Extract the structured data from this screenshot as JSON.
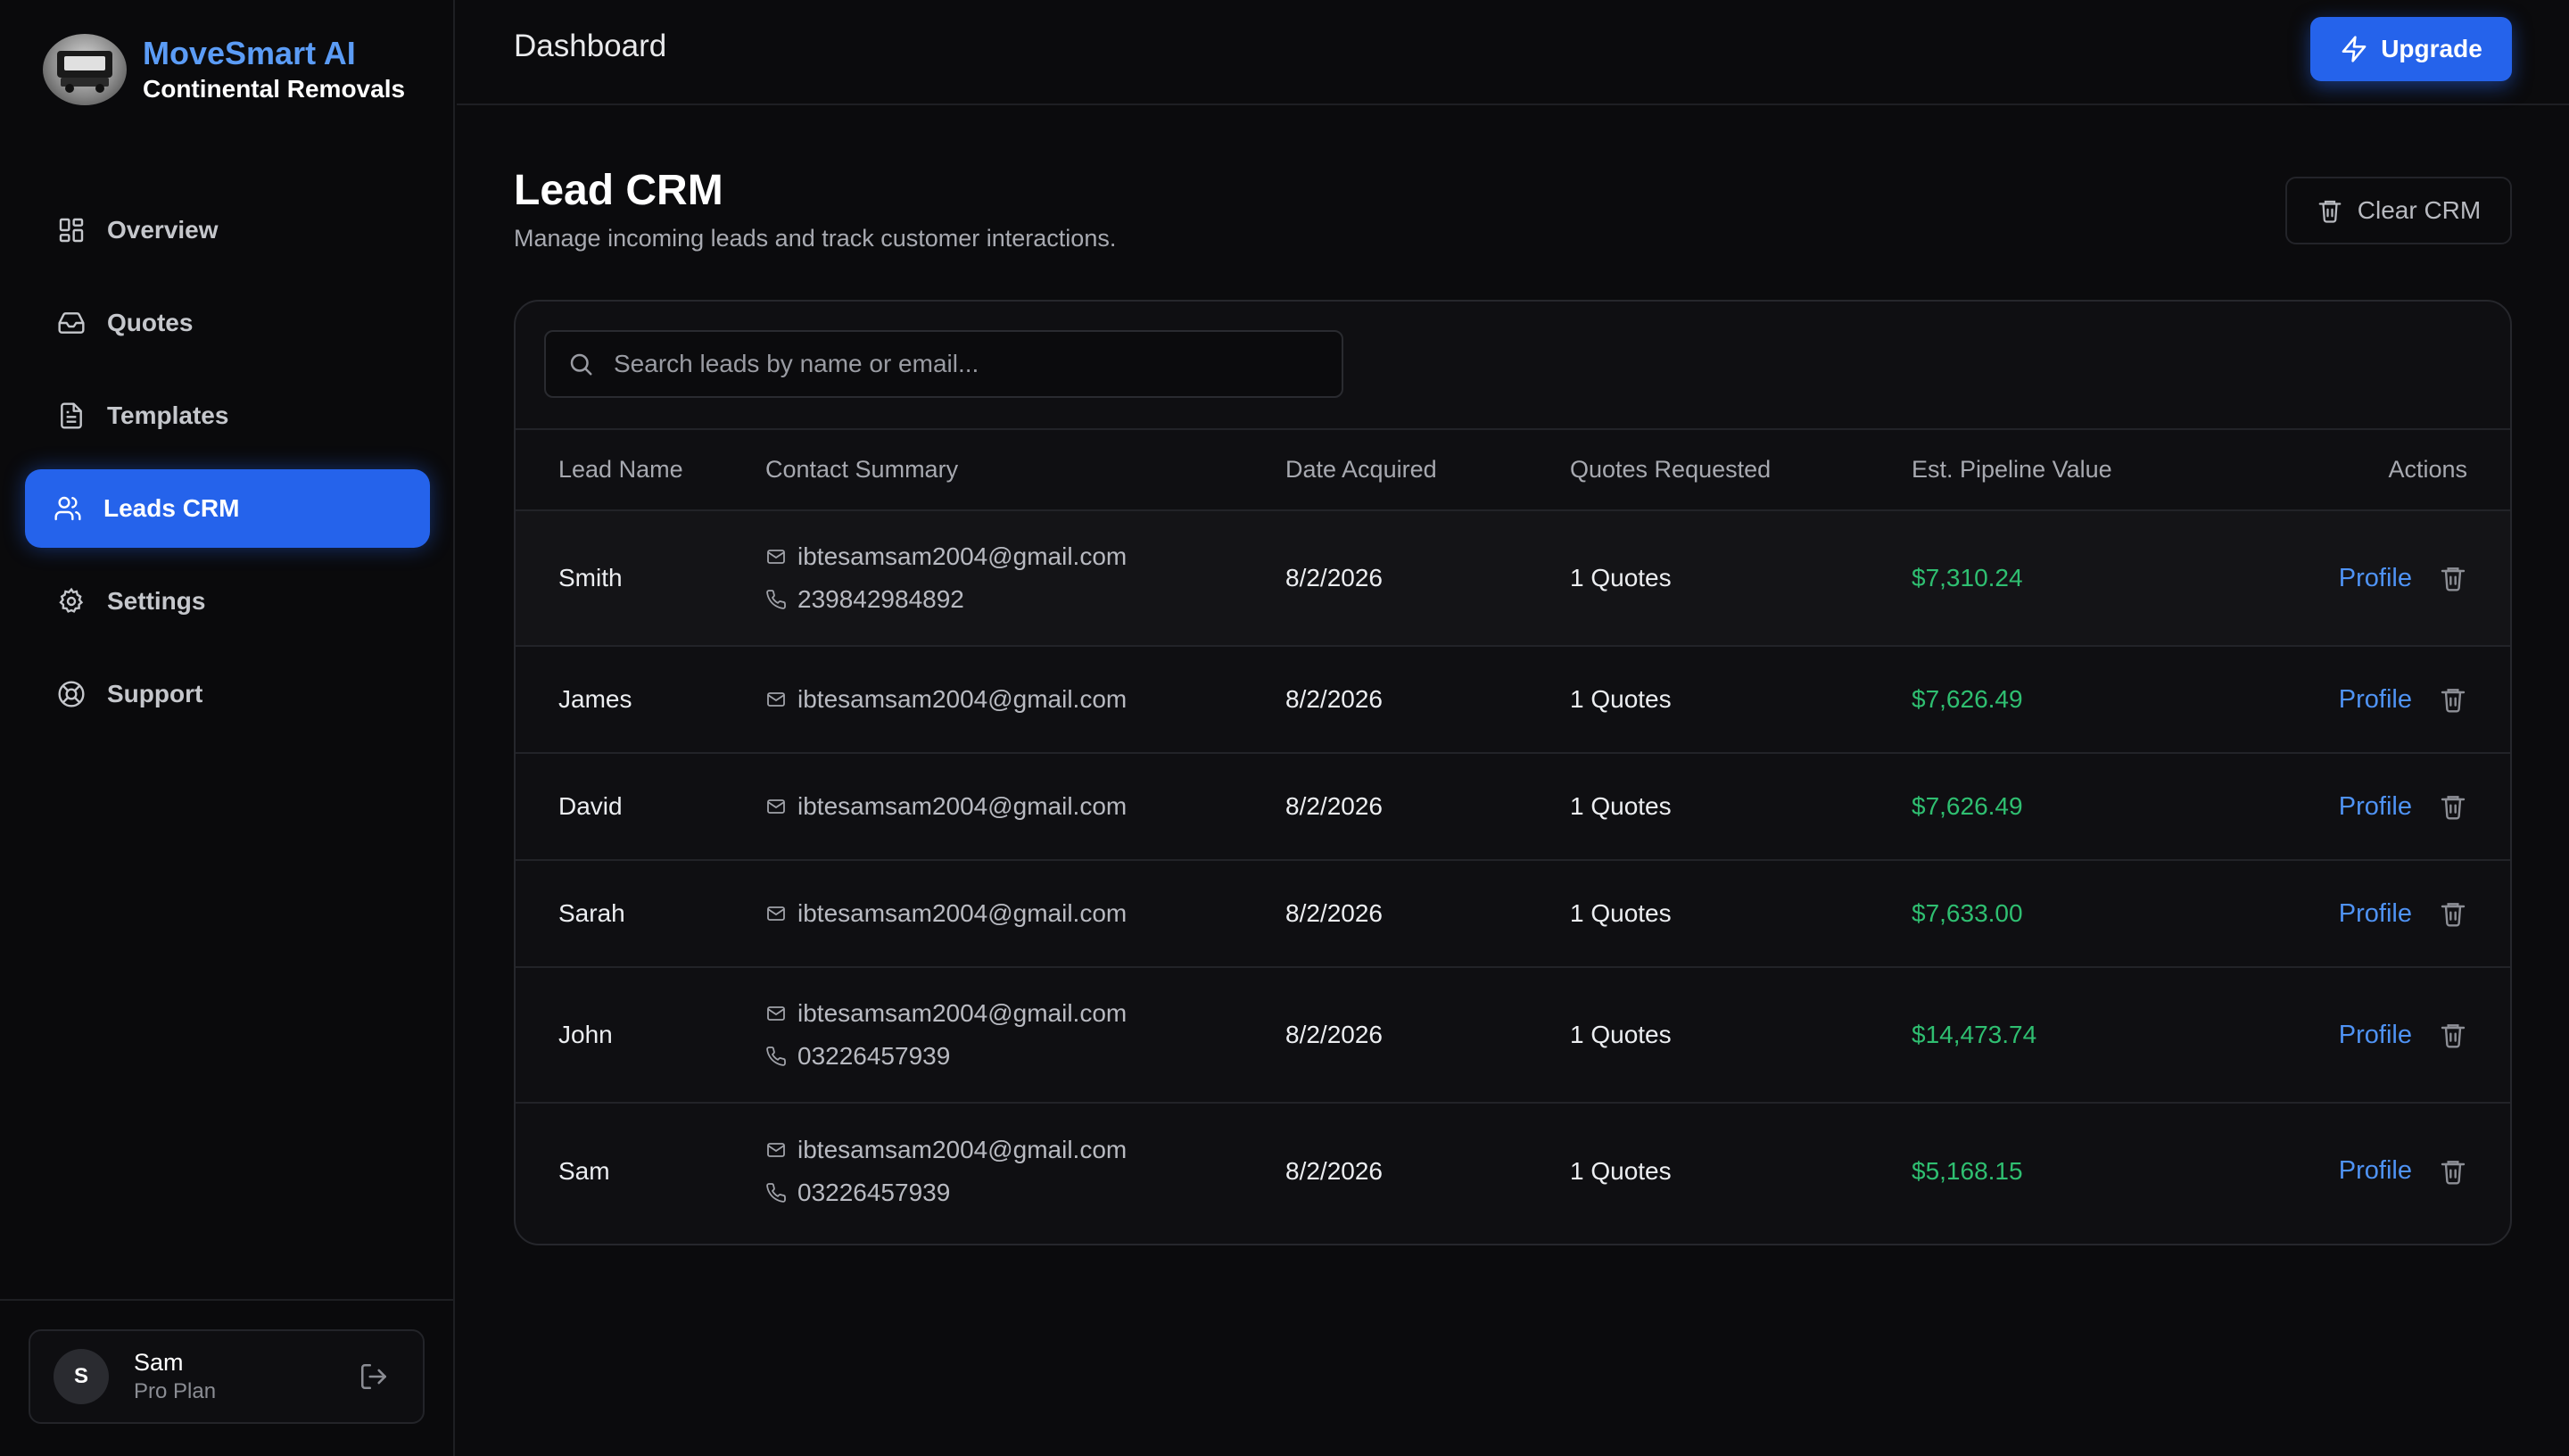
{
  "brand": {
    "title": "MoveSmart AI",
    "subtitle": "Continental Removals"
  },
  "sidebar": {
    "items": [
      {
        "label": "Overview",
        "icon": "grid-icon"
      },
      {
        "label": "Quotes",
        "icon": "inbox-icon"
      },
      {
        "label": "Templates",
        "icon": "document-icon"
      },
      {
        "label": "Leads CRM",
        "icon": "users-icon",
        "active": true
      },
      {
        "label": "Settings",
        "icon": "gear-icon"
      },
      {
        "label": "Support",
        "icon": "lifebuoy-icon"
      }
    ]
  },
  "user": {
    "initial": "S",
    "name": "Sam",
    "plan": "Pro Plan"
  },
  "header": {
    "title": "Dashboard",
    "upgrade_label": "Upgrade"
  },
  "main": {
    "title": "Lead CRM",
    "subtitle": "Manage incoming leads and track customer interactions.",
    "clear_label": "Clear CRM",
    "search_placeholder": "Search leads by name or email..."
  },
  "table": {
    "columns": [
      "Lead Name",
      "Contact Summary",
      "Date Acquired",
      "Quotes Requested",
      "Est. Pipeline Value",
      "Actions"
    ],
    "action_label": "Profile",
    "rows": [
      {
        "name": "Smith",
        "email": "ibtesamsam2004@gmail.com",
        "phone": "239842984892",
        "date": "8/2/2026",
        "quotes": "1 Quotes",
        "value": "$7,310.24"
      },
      {
        "name": "James",
        "email": "ibtesamsam2004@gmail.com",
        "phone": "",
        "date": "8/2/2026",
        "quotes": "1 Quotes",
        "value": "$7,626.49"
      },
      {
        "name": "David",
        "email": "ibtesamsam2004@gmail.com",
        "phone": "",
        "date": "8/2/2026",
        "quotes": "1 Quotes",
        "value": "$7,626.49"
      },
      {
        "name": "Sarah",
        "email": "ibtesamsam2004@gmail.com",
        "phone": "",
        "date": "8/2/2026",
        "quotes": "1 Quotes",
        "value": "$7,633.00"
      },
      {
        "name": "John",
        "email": "ibtesamsam2004@gmail.com",
        "phone": "03226457939",
        "date": "8/2/2026",
        "quotes": "1 Quotes",
        "value": "$14,473.74"
      },
      {
        "name": "Sam",
        "email": "ibtesamsam2004@gmail.com",
        "phone": "03226457939",
        "date": "8/2/2026",
        "quotes": "1 Quotes",
        "value": "$5,168.15"
      }
    ]
  },
  "colors": {
    "accent": "#2563eb",
    "link": "#4f93f5",
    "value_green": "#2fbf71",
    "brand_blue": "#5b9cf6"
  }
}
